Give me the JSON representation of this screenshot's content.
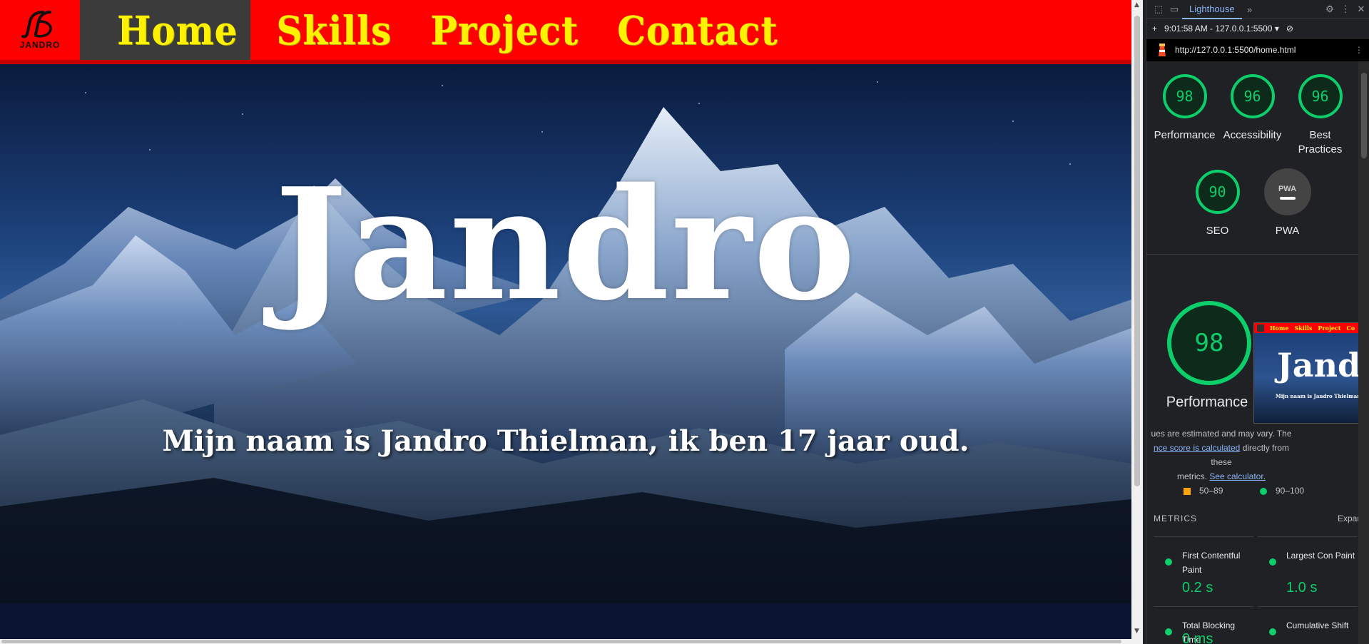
{
  "site": {
    "logo_text": "JANDRO",
    "nav": [
      "Home",
      "Skills",
      "Project",
      "Contact"
    ],
    "hero_title": "Jandro",
    "hero_subtitle": "Mijn naam is Jandro Thielman, ik ben 17 jaar oud."
  },
  "devtools": {
    "active_tab": "Lighthouse",
    "report_selector": "9:01:58 AM - 127.0.0.1:5500",
    "url": "http://127.0.0.1:5500/home.html",
    "scores": [
      {
        "label": "Performance",
        "value": "98"
      },
      {
        "label": "Accessibility",
        "value": "96"
      },
      {
        "label": "Best Practices",
        "value": "96"
      }
    ],
    "seo": {
      "label": "SEO",
      "value": "90"
    },
    "pwa": {
      "label": "PWA",
      "badge": "PWA"
    },
    "performance_big": {
      "label": "Performance",
      "value": "98"
    },
    "thumbnail_nav": [
      "Home",
      "Skills",
      "Project",
      "Co"
    ],
    "thumbnail_title": "Jandro",
    "thumbnail_subtitle": "Mijn naam is Jandro Thielman",
    "note_line1": "ues are estimated and may vary. The",
    "note_link1": "nce score is calculated",
    "note_line2": " directly from these",
    "note_line3": "metrics. ",
    "note_link2": "See calculator.",
    "legend": {
      "orange": "50–89",
      "green": "90–100"
    },
    "metrics_title": "METRICS",
    "metrics_expand": "Expan",
    "metrics": [
      {
        "name": "First Contentful Paint",
        "value": "0.2 s"
      },
      {
        "name": "Largest Con Paint",
        "value": "1.0 s"
      },
      {
        "name": "Total Blocking Time",
        "value": "0 ms"
      },
      {
        "name": "Cumulative Shift",
        "value": ""
      }
    ],
    "score_color": "#0cce6b",
    "average_color": "#ffa400"
  },
  "colors": {
    "nav_background": "#fe0000",
    "nav_text": "#fff200",
    "nav_active": "#3b3b3b"
  }
}
